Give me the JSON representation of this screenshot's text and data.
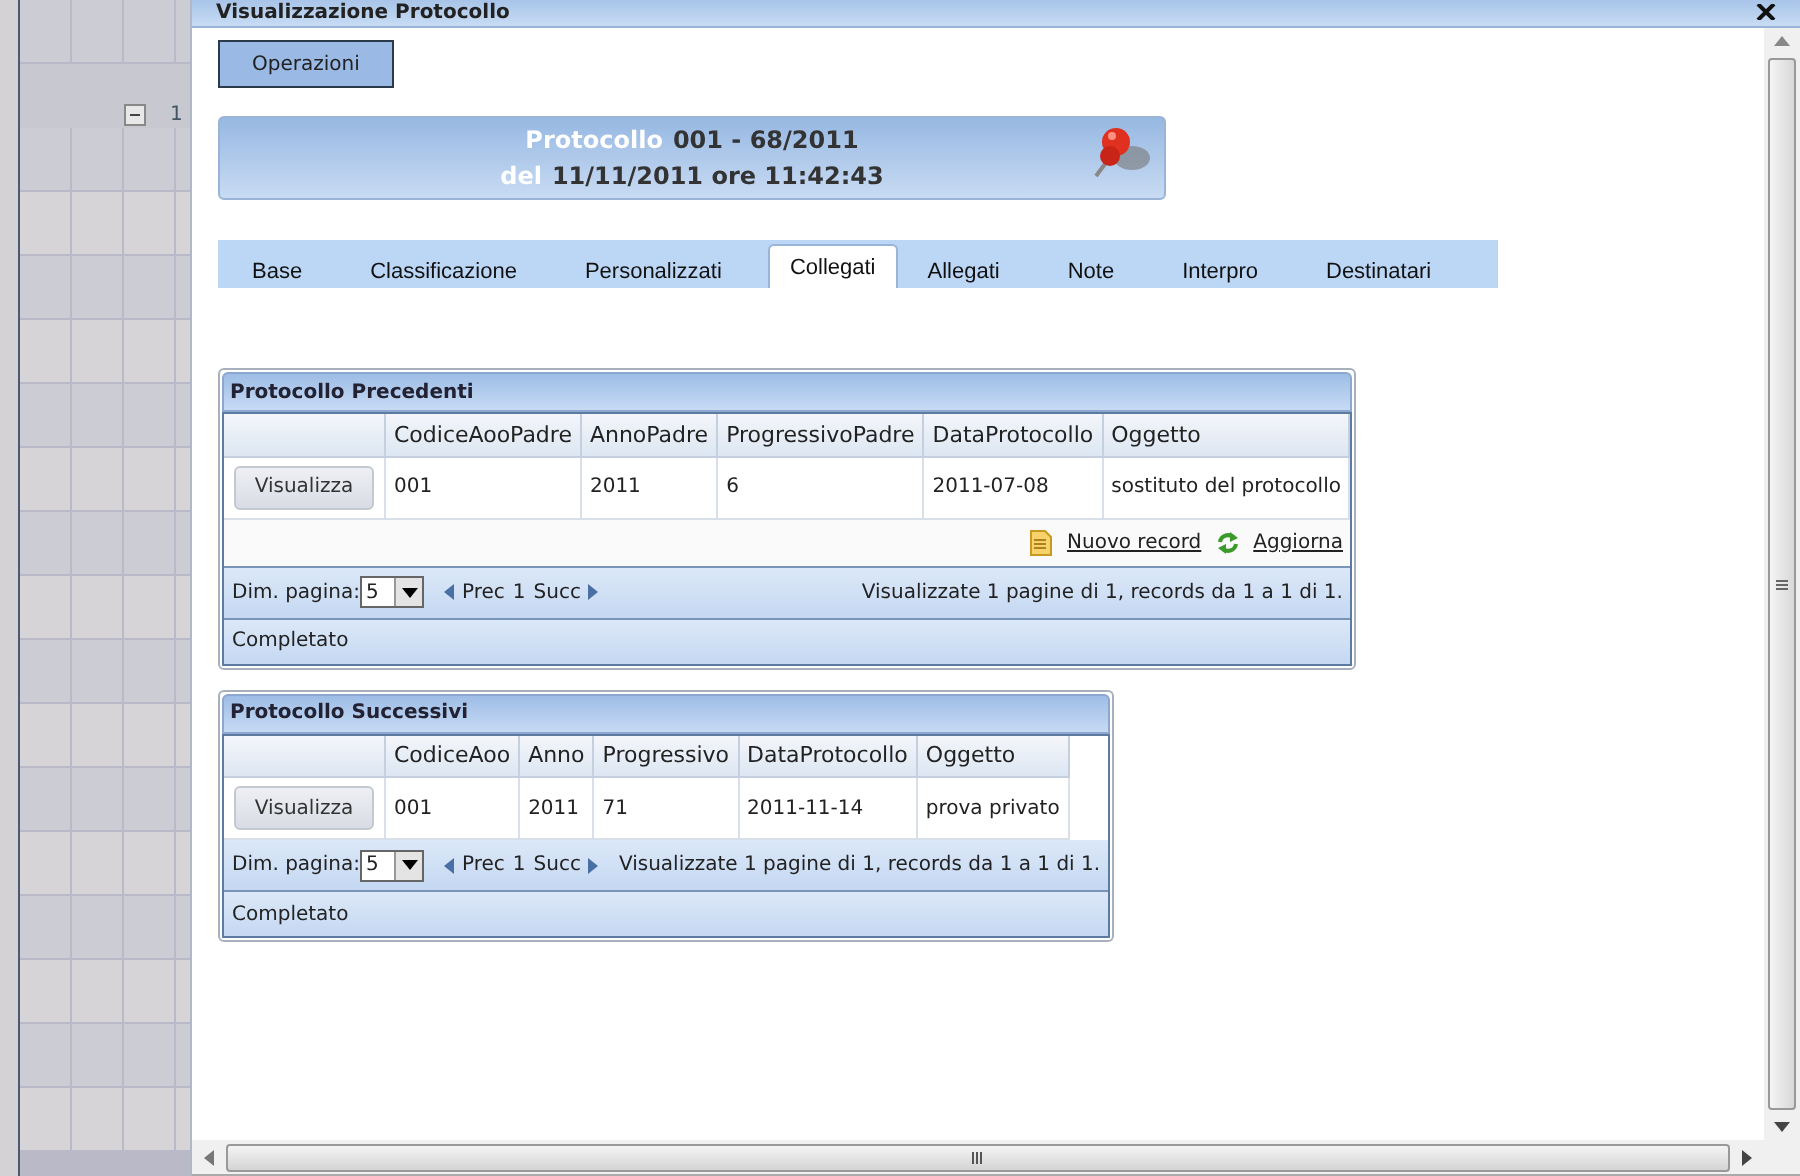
{
  "window": {
    "title": "Visualizzazione Protocollo"
  },
  "background": {
    "row_label": "1"
  },
  "operations_button": "Operazioni",
  "header": {
    "line1": [
      {
        "kind": "label",
        "text": "Protocollo"
      },
      {
        "kind": "value",
        "text": "001 - 68/2011"
      }
    ],
    "line2": [
      {
        "kind": "label",
        "text": "del"
      },
      {
        "kind": "value",
        "text": "11/11/2011 ore 11:42:43"
      }
    ]
  },
  "tabs": [
    {
      "label": "Base",
      "selected": false
    },
    {
      "label": "Classificazione",
      "selected": false
    },
    {
      "label": "Personalizzati",
      "selected": false
    },
    {
      "label": "Collegati",
      "selected": true
    },
    {
      "label": "Allegati",
      "selected": false
    },
    {
      "label": "Note",
      "selected": false
    },
    {
      "label": "Interpro",
      "selected": false
    },
    {
      "label": "Destinatari",
      "selected": false
    }
  ],
  "grids": [
    {
      "title": "Protocollo Precedenti",
      "columns": [
        "CodiceAooPadre",
        "AnnoPadre",
        "ProgressivoPadre",
        "DataProtocollo",
        "Oggetto"
      ],
      "rows": [
        {
          "action": "Visualizza",
          "cells": [
            "001",
            "2011",
            "6",
            "2011-07-08",
            "sostituto del protocollo"
          ]
        }
      ],
      "links": [
        {
          "kind": "new",
          "label": "Nuovo record"
        },
        {
          "kind": "refresh",
          "label": "Aggiorna"
        }
      ],
      "page_size_label": "Dim. pagina:",
      "page_size": "5",
      "prev": "Prec",
      "page": "1",
      "next": "Succ",
      "summary": "Visualizzate 1 pagine di 1, records da 1 a 1 di 1.",
      "status": "Completato"
    },
    {
      "title": "Protocollo Successivi",
      "columns": [
        "CodiceAoo",
        "Anno",
        "Progressivo",
        "DataProtocollo",
        "Oggetto"
      ],
      "rows": [
        {
          "action": "Visualizza",
          "cells": [
            "001",
            "2011",
            "71",
            "2011-11-14",
            "prova privato"
          ]
        }
      ],
      "page_size_label": "Dim. pagina:",
      "page_size": "5",
      "prev": "Prec",
      "page": "1",
      "next": "Succ",
      "summary": "Visualizzate 1 pagine di 1, records da 1 a 1 di 1.",
      "status": "Completato"
    }
  ]
}
